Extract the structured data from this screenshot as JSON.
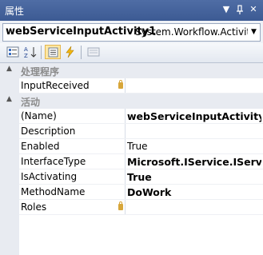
{
  "window": {
    "title": "属性",
    "pin_glyph": "ᵠ",
    "close_glyph": "✕",
    "dropdown_glyph": "▼"
  },
  "selector": {
    "object_name": "webServiceInputActivity1",
    "object_type": "System.Workflow.Activitie"
  },
  "toolbar": {
    "buttons": [
      "categorized-icon",
      "alphabetical-icon",
      "properties-icon",
      "events-icon",
      "property-pages-icon"
    ]
  },
  "grid": {
    "categories": [
      {
        "name": "处理程序",
        "properties": [
          {
            "name": "InputReceived",
            "value": "",
            "locked": true
          }
        ]
      },
      {
        "name": "活动",
        "properties": [
          {
            "name": "(Name)",
            "value": "webServiceInputActivity1",
            "bold": true
          },
          {
            "name": "Description",
            "value": ""
          },
          {
            "name": "Enabled",
            "value": "True"
          },
          {
            "name": "InterfaceType",
            "value": "Microsoft.IService.IService_",
            "bold": true
          },
          {
            "name": "IsActivating",
            "value": "True",
            "bold": true
          },
          {
            "name": "MethodName",
            "value": "DoWork",
            "bold": true
          },
          {
            "name": "Roles",
            "value": "",
            "locked": true
          }
        ]
      }
    ]
  },
  "colors": {
    "titlebar": "#3c5a93",
    "category_gray": "#8b8b8b",
    "lock_gold": "#d7a63a"
  }
}
